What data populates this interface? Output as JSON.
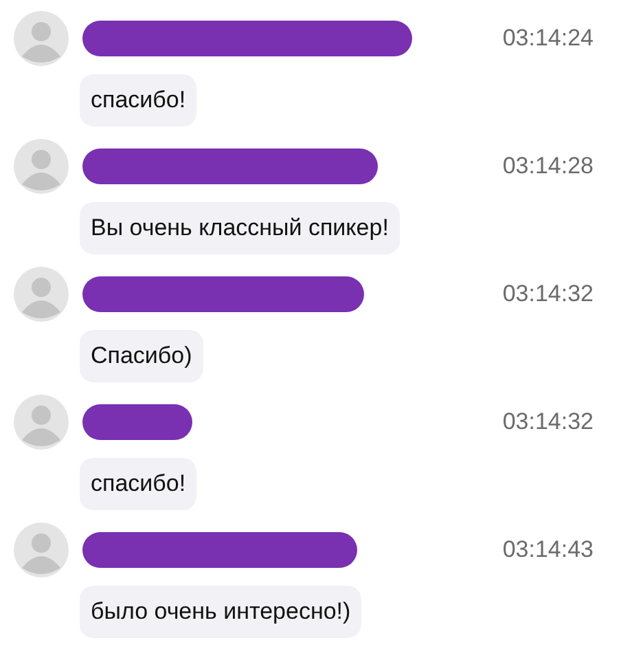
{
  "messages": [
    {
      "time": "03:14:24",
      "text": "спасибо!"
    },
    {
      "time": "03:14:28",
      "text": "Вы очень классный спикер!"
    },
    {
      "time": "03:14:32",
      "text": "Спасибо)"
    },
    {
      "time": "03:14:32",
      "text": "спасибо!"
    },
    {
      "time": "03:14:43",
      "text": "было очень интересно!)"
    }
  ]
}
